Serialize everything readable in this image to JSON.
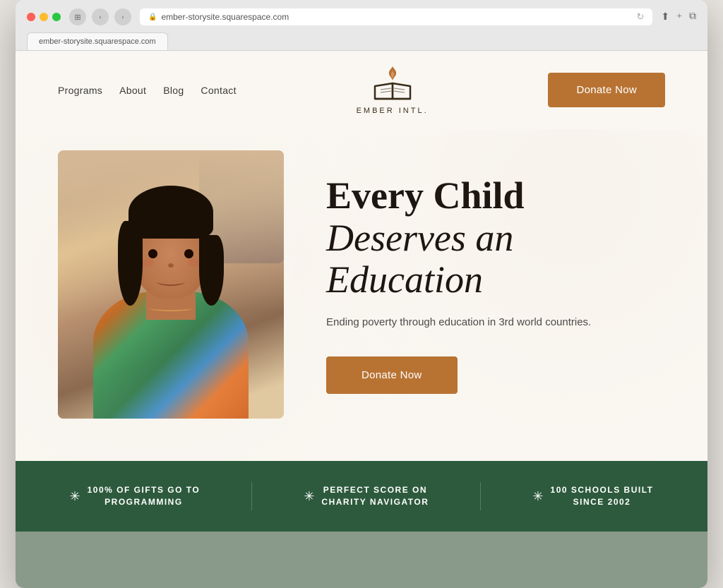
{
  "browser": {
    "url": "ember-storysite.squarespace.com",
    "tab_label": "ember-storysite.squarespace.com"
  },
  "site": {
    "name": "EMBER INTL."
  },
  "nav": {
    "items": [
      {
        "label": "Programs"
      },
      {
        "label": "About"
      },
      {
        "label": "Blog"
      },
      {
        "label": "Contact"
      }
    ]
  },
  "header": {
    "donate_button": "Donate Now"
  },
  "hero": {
    "title_line1": "Every Child",
    "title_line2": "Deserves an",
    "title_line3": "Education",
    "subtitle": "Ending poverty through education in 3rd world countries.",
    "donate_button": "Donate Now"
  },
  "stats": [
    {
      "icon": "✳",
      "text": "100% OF GIFTS GO TO\nPROGRAMMING"
    },
    {
      "icon": "✳",
      "text": "PERFECT SCORE ON\nCHARITY NAVIGATOR"
    },
    {
      "icon": "✳",
      "text": "100 SCHOOLS BUILT\nSINCE 2002"
    }
  ]
}
